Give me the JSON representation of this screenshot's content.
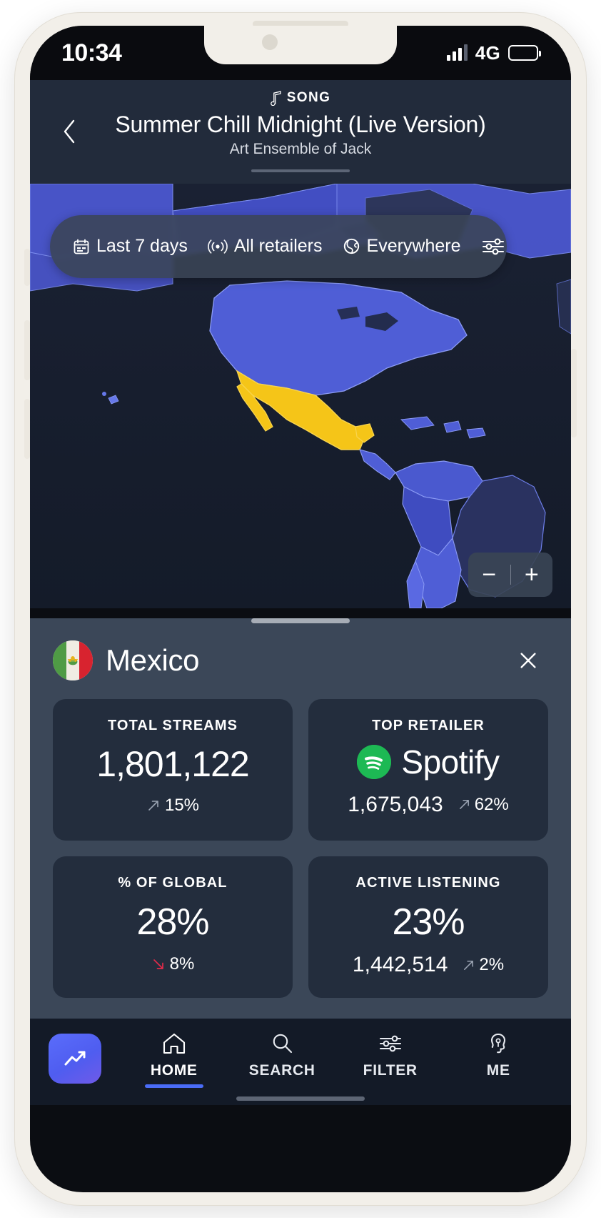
{
  "status_bar": {
    "time": "10:34",
    "network": "4G",
    "signal_icon": "signal-bars-icon",
    "battery_icon": "battery-icon"
  },
  "header": {
    "kicker": "SONG",
    "kicker_icon": "music-note-icon",
    "title": "Summer Chill Midnight (Live Version)",
    "artist": "Art Ensemble of Jack",
    "back_icon": "chevron-left-icon"
  },
  "filters": {
    "date": {
      "label": "Last 7 days",
      "icon": "calendar-icon"
    },
    "retailer": {
      "label": "All retailers",
      "icon": "broadcast-icon"
    },
    "region": {
      "label": "Everywhere",
      "icon": "globe-icon"
    },
    "settings_icon": "sliders-icon"
  },
  "map": {
    "zoom_out_label": "−",
    "zoom_in_label": "+",
    "highlight_color": "#f5c518",
    "region_color": "#4f5ed6"
  },
  "sheet": {
    "country": "Mexico",
    "flag_icon": "mexico-flag-icon",
    "close_icon": "close-icon",
    "cards": [
      {
        "label": "TOTAL STREAMS",
        "value": "1,801,122",
        "delta": "15%",
        "delta_direction": "up",
        "delta_color": "#9aa3b2"
      },
      {
        "label": "TOP RETAILER",
        "retailer": "Spotify",
        "retailer_icon": "spotify-icon",
        "value": "1,675,043",
        "delta": "62%",
        "delta_direction": "up",
        "delta_color": "#9aa3b2"
      },
      {
        "label": "% OF GLOBAL",
        "value": "28%",
        "delta": "8%",
        "delta_direction": "down",
        "delta_color": "#e12b4a"
      },
      {
        "label": "ACTIVE LISTENING",
        "value": "23%",
        "sub_value": "1,442,514",
        "delta": "2%",
        "delta_direction": "up",
        "delta_color": "#9aa3b2"
      }
    ]
  },
  "bottom_nav": {
    "app_badge_icon": "trending-chart-icon",
    "accent_color": "#4a6cf7",
    "items": [
      {
        "label": "HOME",
        "icon": "home-icon",
        "active": true
      },
      {
        "label": "SEARCH",
        "icon": "search-icon",
        "active": false
      },
      {
        "label": "FILTER",
        "icon": "sliders-icon",
        "active": false
      },
      {
        "label": "ME",
        "icon": "profile-icon",
        "active": false
      }
    ]
  }
}
